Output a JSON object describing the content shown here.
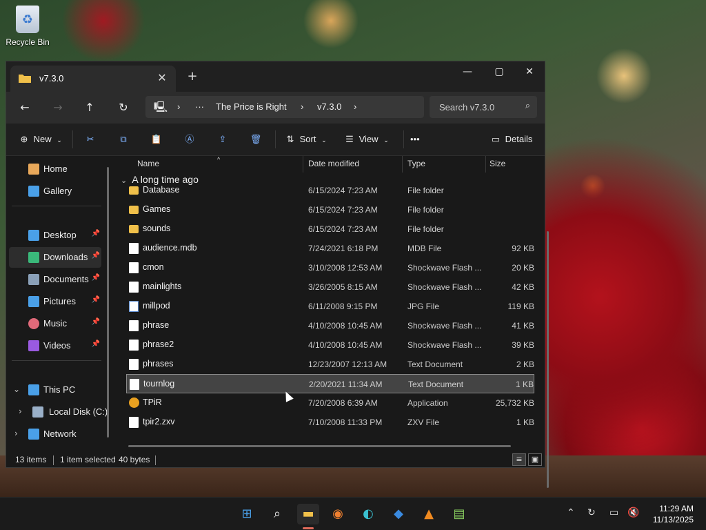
{
  "desktop": {
    "recycle_bin_label": "Recycle Bin"
  },
  "window": {
    "tab_title": "v7.3.0",
    "controls": {
      "minimize": "—",
      "maximize": "▢",
      "close": "✕"
    },
    "new_tab": "+"
  },
  "nav": {
    "breadcrumbs": [
      "The Price is Right",
      "v7.3.0"
    ],
    "search_placeholder": "Search v7.3.0"
  },
  "toolbar": {
    "new_label": "New",
    "sort_label": "Sort",
    "view_label": "View",
    "more_label": "•••",
    "details_label": "Details"
  },
  "sidebar": {
    "items": [
      {
        "label": "Home",
        "icon": "home-icon",
        "color": "#e8a85a"
      },
      {
        "label": "Gallery",
        "icon": "gallery-icon",
        "color": "#4aa0e8"
      },
      {
        "label": "Desktop",
        "icon": "desktop-icon",
        "color": "#4aa0e8",
        "pinned": true
      },
      {
        "label": "Downloads",
        "icon": "downloads-icon",
        "color": "#3ab87a",
        "pinned": true,
        "selected": true
      },
      {
        "label": "Documents",
        "icon": "documents-icon",
        "color": "#8aa0b8",
        "pinned": true
      },
      {
        "label": "Pictures",
        "icon": "pictures-icon",
        "color": "#4aa0e8",
        "pinned": true
      },
      {
        "label": "Music",
        "icon": "music-icon",
        "color": "#e06a7a",
        "pinned": true
      },
      {
        "label": "Videos",
        "icon": "videos-icon",
        "color": "#9a5ae0",
        "pinned": true
      },
      {
        "label": "This PC",
        "icon": "this-pc-icon",
        "color": "#4aa0e8"
      },
      {
        "label": "Local Disk (C:)",
        "icon": "drive-icon",
        "color": "#9ab0c8"
      },
      {
        "label": "Network",
        "icon": "network-icon",
        "color": "#4aa0e8"
      }
    ]
  },
  "columns": {
    "name": "Name",
    "date": "Date modified",
    "type": "Type",
    "size": "Size"
  },
  "group_label": "A long time ago",
  "files": [
    {
      "name": "Database",
      "date": "6/15/2024 7:23 AM",
      "type": "File folder",
      "size": "",
      "kind": "folder"
    },
    {
      "name": "Games",
      "date": "6/15/2024 7:23 AM",
      "type": "File folder",
      "size": "",
      "kind": "folder"
    },
    {
      "name": "sounds",
      "date": "6/15/2024 7:23 AM",
      "type": "File folder",
      "size": "",
      "kind": "folder"
    },
    {
      "name": "audience.mdb",
      "date": "7/24/2021 6:18 PM",
      "type": "MDB File",
      "size": "92 KB",
      "kind": "file"
    },
    {
      "name": "cmon",
      "date": "3/10/2008 12:53 AM",
      "type": "Shockwave Flash ...",
      "size": "20 KB",
      "kind": "file"
    },
    {
      "name": "mainlights",
      "date": "3/26/2005 8:15 AM",
      "type": "Shockwave Flash ...",
      "size": "42 KB",
      "kind": "file"
    },
    {
      "name": "millpod",
      "date": "6/11/2008 9:15 PM",
      "type": "JPG File",
      "size": "119 KB",
      "kind": "img"
    },
    {
      "name": "phrase",
      "date": "4/10/2008 10:45 AM",
      "type": "Shockwave Flash ...",
      "size": "41 KB",
      "kind": "file"
    },
    {
      "name": "phrase2",
      "date": "4/10/2008 10:45 AM",
      "type": "Shockwave Flash ...",
      "size": "39 KB",
      "kind": "file"
    },
    {
      "name": "phrases",
      "date": "12/23/2007 12:13 AM",
      "type": "Text Document",
      "size": "2 KB",
      "kind": "file"
    },
    {
      "name": "tournlog",
      "date": "2/20/2021 11:34 AM",
      "type": "Text Document",
      "size": "1 KB",
      "kind": "file",
      "selected": true
    },
    {
      "name": "TPiR",
      "date": "7/20/2008 6:39 AM",
      "type": "Application",
      "size": "25,732 KB",
      "kind": "app"
    },
    {
      "name": "tpir2.zxv",
      "date": "7/10/2008 11:33 PM",
      "type": "ZXV File",
      "size": "1 KB",
      "kind": "file"
    }
  ],
  "status": {
    "count": "13 items",
    "selection": "1 item selected",
    "bytes": "40 bytes"
  },
  "taskbar": {
    "apps": [
      "start-icon",
      "search-icon",
      "file-explorer-icon",
      "firefox-icon",
      "edge-icon",
      "vscode-icon",
      "vlc-icon",
      "notepad-plus-icon"
    ],
    "time": "11:29 AM",
    "date": "11/13/2025"
  }
}
